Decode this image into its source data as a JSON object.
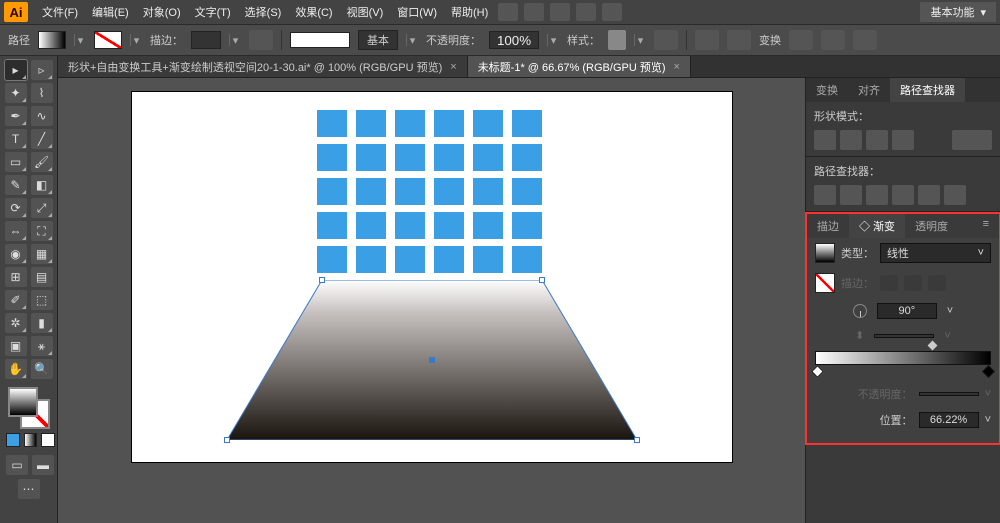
{
  "menubar": {
    "items": [
      "文件(F)",
      "编辑(E)",
      "对象(O)",
      "文字(T)",
      "选择(S)",
      "效果(C)",
      "视图(V)",
      "窗口(W)",
      "帮助(H)"
    ],
    "workspace": "基本功能"
  },
  "controlbar": {
    "left_label": "路径",
    "stroke_label": "描边：",
    "basic_label": "基本",
    "opacity_label": "不透明度：",
    "opacity_value": "100%",
    "style_label": "样式：",
    "transform_btn": "变换"
  },
  "tabs": [
    {
      "title": "形状+自由变换工具+渐变绘制透视空间20-1-30.ai* @ 100% (RGB/GPU 预览)",
      "active": false
    },
    {
      "title": "未标题-1* @ 66.67% (RGB/GPU 预览)",
      "active": true
    }
  ],
  "panels": {
    "top_tabs": [
      "变换",
      "对齐",
      "路径查找器"
    ],
    "top_active": 2,
    "shape_mode": "形状模式：",
    "pathfinder": "路径查找器："
  },
  "gradient": {
    "tabs": [
      "描边",
      "◇ 渐变",
      "透明度"
    ],
    "active_tab": 1,
    "type_label": "类型：",
    "type_value": "线性",
    "stroke_label": "描边：",
    "angle_value": "90°",
    "ratio_icon": "比",
    "opacity_label": "不透明度：",
    "location_label": "位置：",
    "location_value": "66.22%",
    "diamond_pos": 66.22
  },
  "chart_data": null
}
